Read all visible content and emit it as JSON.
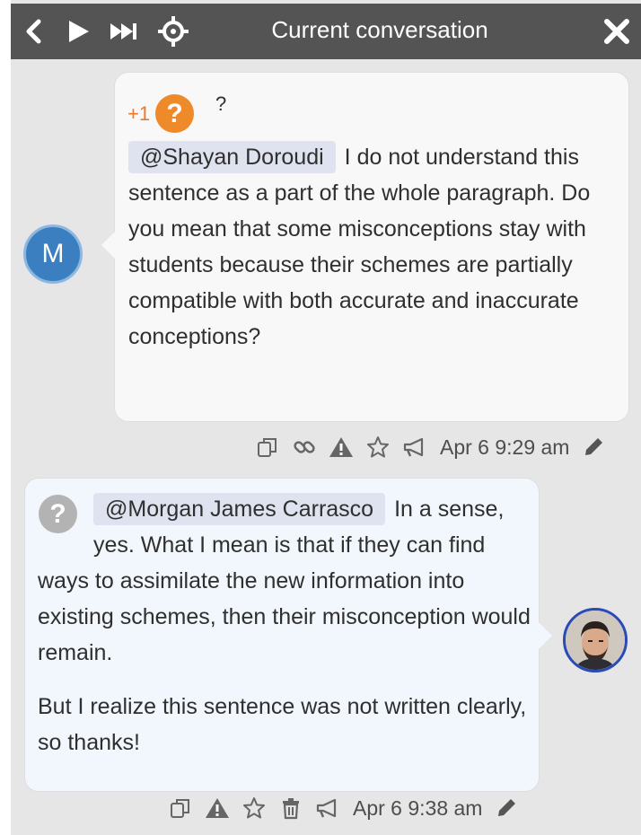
{
  "header": {
    "title": "Current conversation"
  },
  "comments": [
    {
      "author_initial": "M",
      "vote_count": "+1",
      "vote_symbol": "?",
      "question_mark": "?",
      "mention": "@Shayan Doroudi",
      "text": "I do not understand this sentence as a part of the whole paragraph. Do you mean that some misconceptions stay with students because their schemes are partially compatible with both accurate and inaccurate conceptions?",
      "timestamp": "Apr 6 9:29 am"
    },
    {
      "status_symbol": "?",
      "mention": "@Morgan James Carrasco",
      "text": "In a sense, yes. What I mean is that if they can find ways to assimilate the new information into existing schemes, then their misconception would remain.",
      "text2": "But I realize this sentence was not written clearly, so thanks!",
      "timestamp": "Apr 6 9:38 am"
    }
  ],
  "colors": {
    "header_bg": "#545454",
    "vote_orange": "#ee8a2a",
    "status_gray": "#b3b3b3",
    "avatar_blue": "#3c7fc0"
  },
  "icons": [
    "back-icon",
    "play-icon",
    "fast-forward-icon",
    "crosshair-icon",
    "close-icon",
    "copy-icon",
    "link-icon",
    "warning-icon",
    "star-icon",
    "trash-icon",
    "megaphone-icon",
    "pencil-icon"
  ]
}
